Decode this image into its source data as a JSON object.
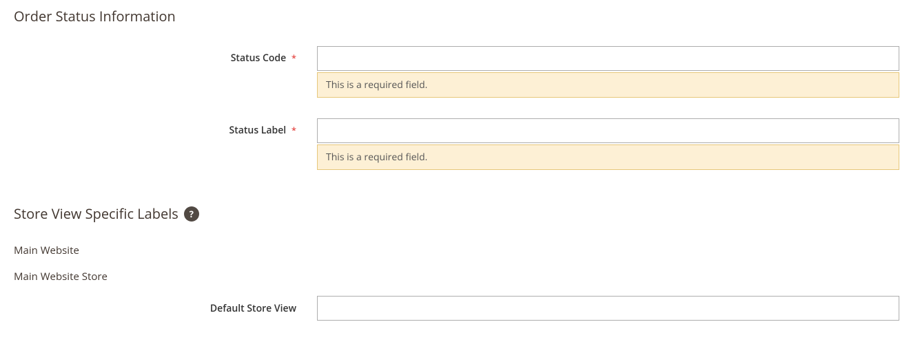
{
  "section1": {
    "title": "Order Status Information",
    "fields": {
      "statusCode": {
        "label": "Status Code",
        "value": "",
        "error": "This is a required field."
      },
      "statusLabel": {
        "label": "Status Label",
        "value": "",
        "error": "This is a required field."
      }
    },
    "requiredMark": "*"
  },
  "section2": {
    "title": "Store View Specific Labels",
    "helpGlyph": "?",
    "tree": {
      "website": "Main Website",
      "store": "Main Website Store",
      "storeView": {
        "label": "Default Store View",
        "value": ""
      }
    }
  }
}
